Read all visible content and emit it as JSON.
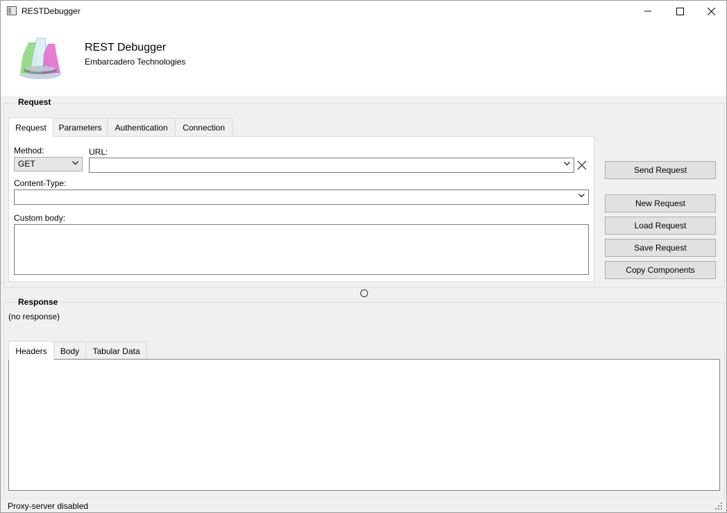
{
  "window": {
    "title": "RESTDebugger",
    "minimize_icon": "minimize-icon",
    "maximize_icon": "maximize-icon",
    "close_icon": "close-icon"
  },
  "header": {
    "title": "REST Debugger",
    "subtitle": "Embarcadero Technologies",
    "logo_icon": "flask-logo"
  },
  "request": {
    "group_label": "Request",
    "tabs": [
      {
        "label": "Request",
        "active": true
      },
      {
        "label": "Parameters",
        "active": false
      },
      {
        "label": "Authentication",
        "active": false
      },
      {
        "label": "Connection",
        "active": false
      }
    ],
    "method_label": "Method:",
    "method_value": "GET",
    "url_label": "URL:",
    "url_value": "",
    "content_type_label": "Content-Type:",
    "content_type_value": "",
    "custom_body_label": "Custom body:",
    "custom_body_value": ""
  },
  "actions": {
    "send": "Send Request",
    "new": "New Request",
    "load": "Load Request",
    "save": "Save Request",
    "copy": "Copy Components"
  },
  "response": {
    "group_label": "Response",
    "status": "(no response)",
    "tabs": [
      {
        "label": "Headers",
        "active": true
      },
      {
        "label": "Body",
        "active": false
      },
      {
        "label": "Tabular Data",
        "active": false
      }
    ]
  },
  "statusbar": {
    "text": "Proxy-server disabled"
  },
  "colors": {
    "window_bg": "#f0f0f0",
    "panel_bg": "#ffffff",
    "button_bg": "#e1e1e1",
    "border": "#adadad"
  }
}
